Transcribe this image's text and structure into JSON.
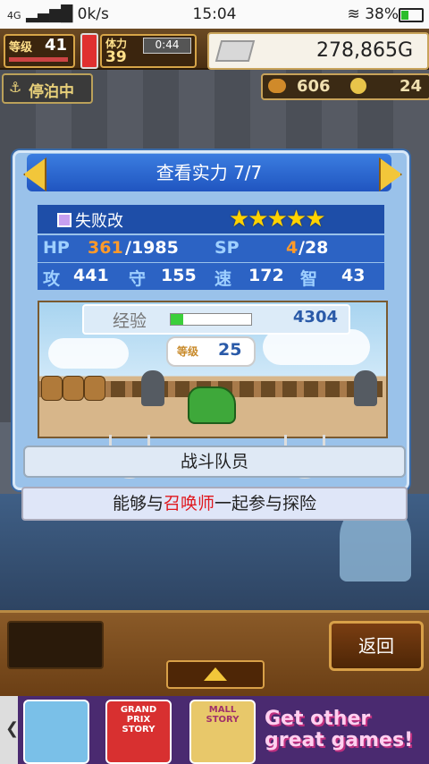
{
  "status_bar": {
    "network": "4G",
    "speed": "0k/s",
    "time": "15:04",
    "battery": "38%",
    "battery_level": 0.38
  },
  "hud": {
    "level_label": "等级",
    "level_value": "41",
    "stamina_label": "体力",
    "stamina_value": "39",
    "timer": "0:44",
    "gold": "278,865G",
    "docked_label": "停泊中",
    "resource_1": "606",
    "resource_2": "24"
  },
  "dialog": {
    "title": "查看实力 7/7",
    "character_name": "失败改",
    "stars": "★★★★★",
    "star_count": 5,
    "hp_label": "HP",
    "hp_current": "361",
    "hp_max": "/1985",
    "sp_label": "SP",
    "sp_current": "4",
    "sp_max": "/28",
    "atk_label": "攻",
    "atk": "441",
    "def_label": "守",
    "def": "155",
    "spd_label": "速",
    "spd": "172",
    "int_label": "智",
    "int": "43",
    "exp_label": "经验",
    "exp_value": "4304",
    "exp_fraction": 0.15,
    "level_label": "等级",
    "level_value": "25",
    "role": "战斗队员",
    "description_pre": "能够与",
    "description_highlight": "召唤师",
    "description_post": "一起参与探险"
  },
  "bottom": {
    "back_label": "返回"
  },
  "ad": {
    "edge_glyph": "❮",
    "game2_label": "GRAND PRIX STORY",
    "game3_label": "MALL STORY",
    "cta": "Get other great games!"
  },
  "colors": {
    "title_blue": "#2055c0",
    "stat_blue": "#2c63c4",
    "highlight_red": "#e0181e",
    "star_gold": "#ffd200"
  }
}
